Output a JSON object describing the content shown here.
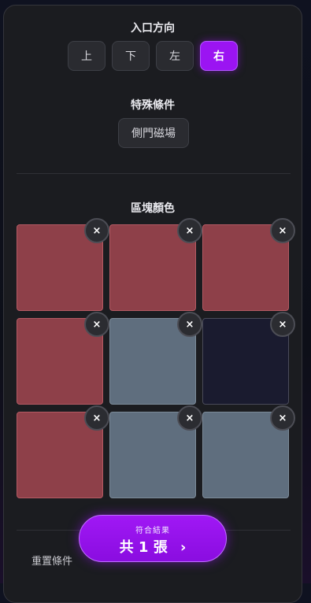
{
  "entrance": {
    "title": "入口方向",
    "options": [
      "上",
      "下",
      "左",
      "右"
    ],
    "selected": "右"
  },
  "special": {
    "title": "特殊條件",
    "option": "側門磁場"
  },
  "blocks": {
    "title": "區塊顏色",
    "clear_glyph": "×",
    "cells": [
      {
        "color": "red"
      },
      {
        "color": "red"
      },
      {
        "color": "red"
      },
      {
        "color": "red"
      },
      {
        "color": "slate"
      },
      {
        "color": "navy"
      },
      {
        "color": "red"
      },
      {
        "color": "slate"
      },
      {
        "color": "slate"
      }
    ],
    "palette": {
      "red": "#8e4049",
      "slate": "#5f6e7e",
      "navy": "#1a1b2f"
    }
  },
  "footer": {
    "reset_label": "重置條件",
    "result_caption": "符合結果",
    "result_prefix": "共",
    "result_count": "1",
    "result_suffix": "張",
    "accent": "#9b14f2"
  }
}
